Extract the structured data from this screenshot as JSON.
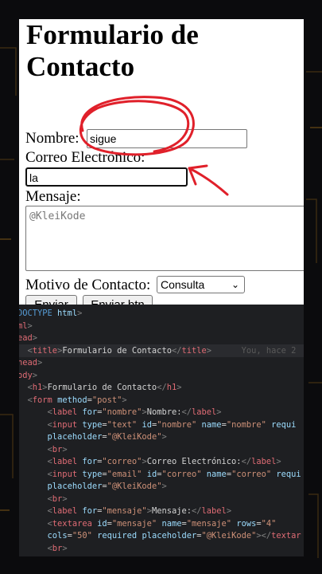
{
  "preview": {
    "title_line1": "Formulario de",
    "title_line2": "Contacto",
    "nombre_label": "Nombre:",
    "nombre_value": "sigue",
    "correo_label": "Correo Electrónico:",
    "correo_value": "la",
    "mensaje_label": "Mensaje:",
    "mensaje_placeholder": "@KleiKode",
    "motivo_label": "Motivo de Contacto:",
    "motivo_selected": "Consulta",
    "enviar_label": "Enviar",
    "enviar_btn_label": "Enviar btn"
  },
  "annotation_color": "#e0202a",
  "editor": {
    "lines": [
      {
        "segments": [
          {
            "t": "DOCTYPE ",
            "c": "c-tag"
          },
          {
            "t": "html",
            "c": "c-attr"
          },
          {
            "t": ">",
            "c": "c-punct"
          }
        ]
      },
      {
        "segments": [
          {
            "t": "ml",
            "c": "c-tagred"
          },
          {
            "t": ">",
            "c": "c-punct"
          }
        ]
      },
      {
        "segments": [
          {
            "t": "ead",
            "c": "c-tagred"
          },
          {
            "t": ">",
            "c": "c-punct"
          }
        ]
      },
      {
        "segments": [
          {
            "t": "  <",
            "c": "c-punct"
          },
          {
            "t": "title",
            "c": "c-tagred"
          },
          {
            "t": ">",
            "c": "c-punct"
          },
          {
            "t": "Formulario de Contacto",
            "c": "c-text"
          },
          {
            "t": "</",
            "c": "c-punct"
          },
          {
            "t": "title",
            "c": "c-tagred"
          },
          {
            "t": ">",
            "c": "c-punct"
          },
          {
            "t": "      You, hace 2",
            "c": "c-ghost"
          }
        ]
      },
      {
        "segments": [
          {
            "t": "head",
            "c": "c-tagred"
          },
          {
            "t": ">",
            "c": "c-punct"
          }
        ]
      },
      {
        "segments": [
          {
            "t": "ody",
            "c": "c-tagred"
          },
          {
            "t": ">",
            "c": "c-punct"
          }
        ]
      },
      {
        "segments": [
          {
            "t": "  <",
            "c": "c-punct"
          },
          {
            "t": "h1",
            "c": "c-tagred"
          },
          {
            "t": ">",
            "c": "c-punct"
          },
          {
            "t": "Formulario de Contacto",
            "c": "c-text"
          },
          {
            "t": "</",
            "c": "c-punct"
          },
          {
            "t": "h1",
            "c": "c-tagred"
          },
          {
            "t": ">",
            "c": "c-punct"
          }
        ]
      },
      {
        "segments": [
          {
            "t": "  <",
            "c": "c-punct"
          },
          {
            "t": "form ",
            "c": "c-tagred"
          },
          {
            "t": "method",
            "c": "c-attr"
          },
          {
            "t": "=",
            "c": "c-text"
          },
          {
            "t": "\"post\"",
            "c": "c-str"
          },
          {
            "t": ">",
            "c": "c-punct"
          }
        ]
      },
      {
        "segments": [
          {
            "t": "      <",
            "c": "c-punct"
          },
          {
            "t": "label ",
            "c": "c-tagred"
          },
          {
            "t": "for",
            "c": "c-attr"
          },
          {
            "t": "=",
            "c": "c-text"
          },
          {
            "t": "\"nombre\"",
            "c": "c-str"
          },
          {
            "t": ">",
            "c": "c-punct"
          },
          {
            "t": "Nombre:",
            "c": "c-text"
          },
          {
            "t": "</",
            "c": "c-punct"
          },
          {
            "t": "label",
            "c": "c-tagred"
          },
          {
            "t": ">",
            "c": "c-punct"
          }
        ]
      },
      {
        "segments": [
          {
            "t": "      <",
            "c": "c-punct"
          },
          {
            "t": "input ",
            "c": "c-tagred"
          },
          {
            "t": "type",
            "c": "c-attr"
          },
          {
            "t": "=",
            "c": "c-text"
          },
          {
            "t": "\"text\" ",
            "c": "c-str"
          },
          {
            "t": "id",
            "c": "c-attr"
          },
          {
            "t": "=",
            "c": "c-text"
          },
          {
            "t": "\"nombre\" ",
            "c": "c-str"
          },
          {
            "t": "name",
            "c": "c-attr"
          },
          {
            "t": "=",
            "c": "c-text"
          },
          {
            "t": "\"nombre\" ",
            "c": "c-str"
          },
          {
            "t": "requi",
            "c": "c-attr"
          }
        ]
      },
      {
        "segments": [
          {
            "t": "      ",
            "c": "c-text"
          },
          {
            "t": "placeholder",
            "c": "c-attr"
          },
          {
            "t": "=",
            "c": "c-text"
          },
          {
            "t": "\"@KleiKode\"",
            "c": "c-str"
          },
          {
            "t": ">",
            "c": "c-punct"
          }
        ]
      },
      {
        "segments": [
          {
            "t": "      <",
            "c": "c-punct"
          },
          {
            "t": "br",
            "c": "c-tagred"
          },
          {
            "t": ">",
            "c": "c-punct"
          }
        ]
      },
      {
        "segments": [
          {
            "t": "      <",
            "c": "c-punct"
          },
          {
            "t": "label ",
            "c": "c-tagred"
          },
          {
            "t": "for",
            "c": "c-attr"
          },
          {
            "t": "=",
            "c": "c-text"
          },
          {
            "t": "\"correo\"",
            "c": "c-str"
          },
          {
            "t": ">",
            "c": "c-punct"
          },
          {
            "t": "Correo Electrónico:",
            "c": "c-text"
          },
          {
            "t": "</",
            "c": "c-punct"
          },
          {
            "t": "label",
            "c": "c-tagred"
          },
          {
            "t": ">",
            "c": "c-punct"
          }
        ]
      },
      {
        "segments": [
          {
            "t": "      <",
            "c": "c-punct"
          },
          {
            "t": "input ",
            "c": "c-tagred"
          },
          {
            "t": "type",
            "c": "c-attr"
          },
          {
            "t": "=",
            "c": "c-text"
          },
          {
            "t": "\"email\" ",
            "c": "c-str"
          },
          {
            "t": "id",
            "c": "c-attr"
          },
          {
            "t": "=",
            "c": "c-text"
          },
          {
            "t": "\"correo\" ",
            "c": "c-str"
          },
          {
            "t": "name",
            "c": "c-attr"
          },
          {
            "t": "=",
            "c": "c-text"
          },
          {
            "t": "\"correo\" ",
            "c": "c-str"
          },
          {
            "t": "requi",
            "c": "c-attr"
          }
        ]
      },
      {
        "segments": [
          {
            "t": "      ",
            "c": "c-text"
          },
          {
            "t": "placeholder",
            "c": "c-attr"
          },
          {
            "t": "=",
            "c": "c-text"
          },
          {
            "t": "\"@KleiKode\"",
            "c": "c-str"
          },
          {
            "t": ">",
            "c": "c-punct"
          }
        ]
      },
      {
        "segments": [
          {
            "t": "      <",
            "c": "c-punct"
          },
          {
            "t": "br",
            "c": "c-tagred"
          },
          {
            "t": ">",
            "c": "c-punct"
          }
        ]
      },
      {
        "segments": [
          {
            "t": "      <",
            "c": "c-punct"
          },
          {
            "t": "label ",
            "c": "c-tagred"
          },
          {
            "t": "for",
            "c": "c-attr"
          },
          {
            "t": "=",
            "c": "c-text"
          },
          {
            "t": "\"mensaje\"",
            "c": "c-str"
          },
          {
            "t": ">",
            "c": "c-punct"
          },
          {
            "t": "Mensaje:",
            "c": "c-text"
          },
          {
            "t": "</",
            "c": "c-punct"
          },
          {
            "t": "label",
            "c": "c-tagred"
          },
          {
            "t": ">",
            "c": "c-punct"
          }
        ]
      },
      {
        "segments": [
          {
            "t": "      <",
            "c": "c-punct"
          },
          {
            "t": "textarea ",
            "c": "c-tagred"
          },
          {
            "t": "id",
            "c": "c-attr"
          },
          {
            "t": "=",
            "c": "c-text"
          },
          {
            "t": "\"mensaje\" ",
            "c": "c-str"
          },
          {
            "t": "name",
            "c": "c-attr"
          },
          {
            "t": "=",
            "c": "c-text"
          },
          {
            "t": "\"mensaje\" ",
            "c": "c-str"
          },
          {
            "t": "rows",
            "c": "c-attr"
          },
          {
            "t": "=",
            "c": "c-text"
          },
          {
            "t": "\"4\"",
            "c": "c-str"
          }
        ]
      },
      {
        "segments": [
          {
            "t": "      ",
            "c": "c-text"
          },
          {
            "t": "cols",
            "c": "c-attr"
          },
          {
            "t": "=",
            "c": "c-text"
          },
          {
            "t": "\"50\" ",
            "c": "c-str"
          },
          {
            "t": "required ",
            "c": "c-attr"
          },
          {
            "t": "placeholder",
            "c": "c-attr"
          },
          {
            "t": "=",
            "c": "c-text"
          },
          {
            "t": "\"@KleiKode\"",
            "c": "c-str"
          },
          {
            "t": "></",
            "c": "c-punct"
          },
          {
            "t": "textar",
            "c": "c-tagred"
          }
        ]
      },
      {
        "segments": [
          {
            "t": "      <",
            "c": "c-punct"
          },
          {
            "t": "br",
            "c": "c-tagred"
          },
          {
            "t": ">",
            "c": "c-punct"
          }
        ]
      }
    ]
  }
}
